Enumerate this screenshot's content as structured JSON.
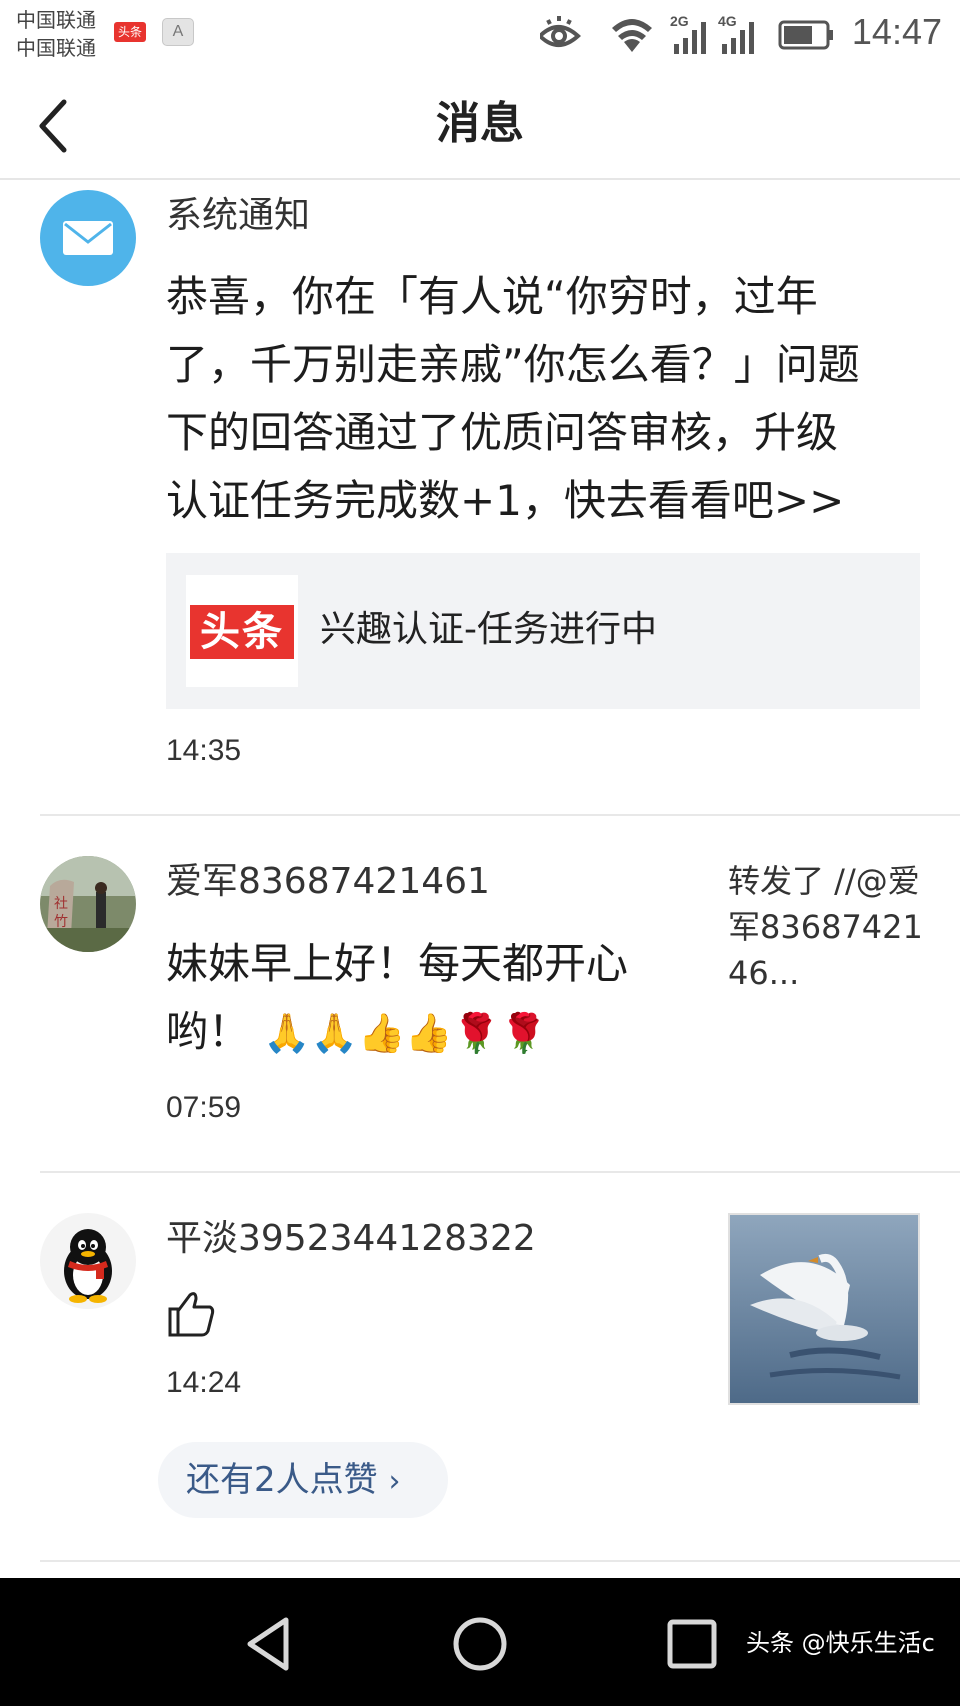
{
  "status_bar": {
    "carrier1": "中国联通",
    "carrier2": "中国联通",
    "net_badge_1": "2G",
    "net_badge_2": "4G",
    "time": "14:47",
    "badge_a": "A"
  },
  "navbar": {
    "title": "消息"
  },
  "messages": [
    {
      "sender": "系统通知",
      "lines": [
        "恭喜，你在「有人说“你穷时，过年",
        "了，千万别走亲戚”你怎么看？」问题",
        "下的回答通过了优质问答审核，升级",
        "认证任务完成数+1，快去看看吧>>"
      ],
      "card": {
        "logo_text": "头条",
        "title": "兴趣认证-任务进行中"
      },
      "time": "14:35"
    },
    {
      "sender": "爱军83687421461",
      "lines": [
        "妹妹早上好！每天都开心",
        "哟！"
      ],
      "emoji": "🙏🙏👍👍🌹🌹",
      "side_text": "转发了 //@爱军8368742146...",
      "time": "07:59"
    },
    {
      "sender": "平淡3952344128322",
      "like_icon": "thumbs-up-outline-icon",
      "time": "14:24",
      "more_likes": "还有2人点赞"
    }
  ],
  "watermark": "头条 @快乐生活c",
  "colors": {
    "accent_red": "#e8342f",
    "system_avatar_blue": "#4fb4ea",
    "link_blue": "#3a5a88"
  }
}
